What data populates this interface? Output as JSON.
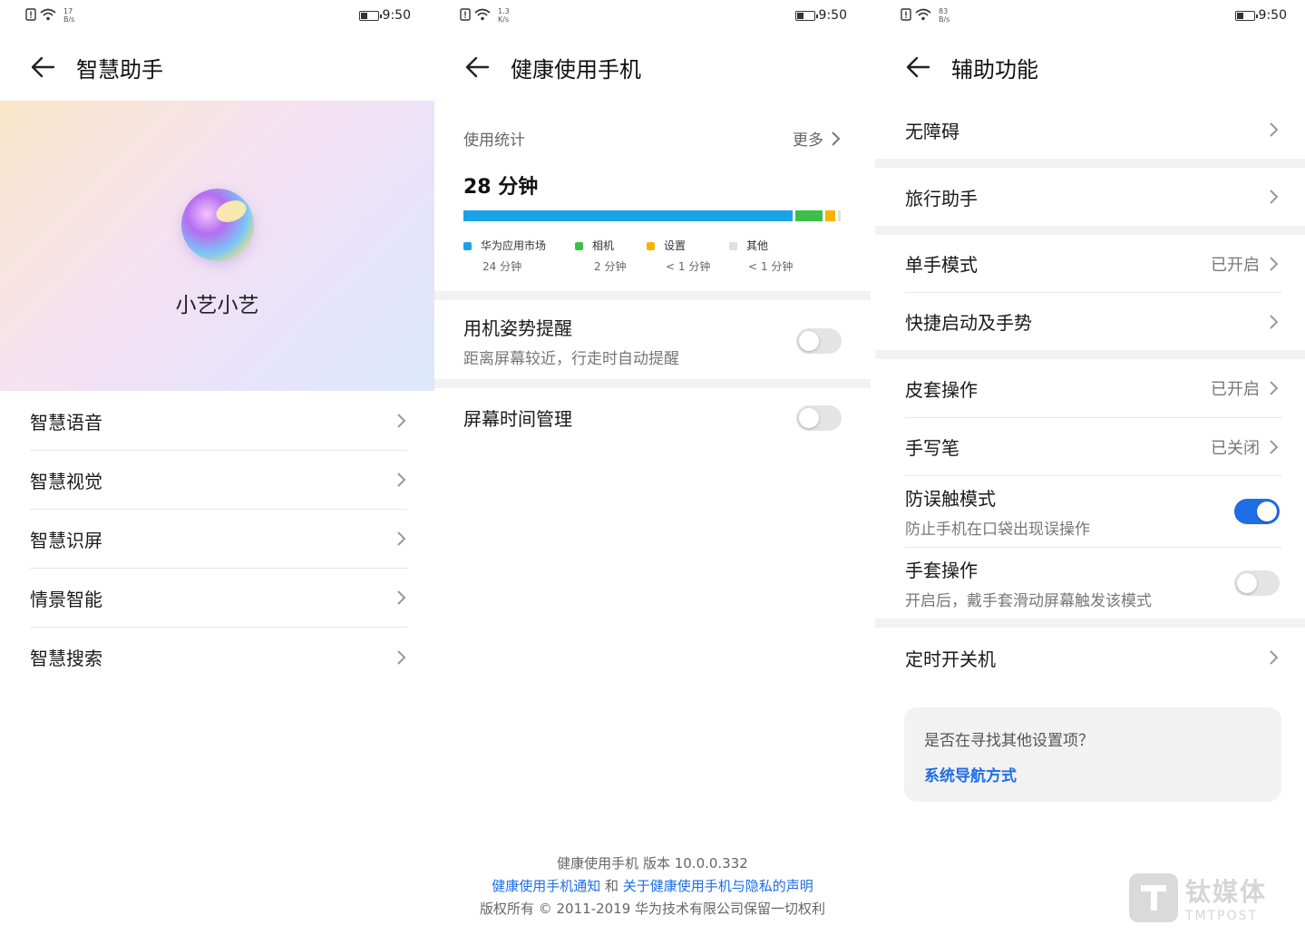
{
  "status_bars": [
    {
      "speed_top": "17",
      "speed_bottom": "B/s",
      "time": "9:50"
    },
    {
      "speed_top": "1.3",
      "speed_bottom": "K/s",
      "time": "9:50"
    },
    {
      "speed_top": "83",
      "speed_bottom": "B/s",
      "time": "9:50"
    }
  ],
  "smart_assistant": {
    "title": "智慧助手",
    "hero_name": "小艺小艺",
    "items": [
      {
        "label": "智慧语音"
      },
      {
        "label": "智慧视觉"
      },
      {
        "label": "智慧识屏"
      },
      {
        "label": "情景智能"
      },
      {
        "label": "智慧搜索"
      }
    ]
  },
  "digital_balance": {
    "title": "健康使用手机",
    "stats_title": "使用统计",
    "more_label": "更多",
    "total": "28 分钟",
    "usage": [
      {
        "name": "华为应用市场",
        "time": "24 分钟",
        "minutes": 24,
        "color": "#1aa3e8"
      },
      {
        "name": "相机",
        "time": "2 分钟",
        "minutes": 2,
        "color": "#3cc04a"
      },
      {
        "name": "设置",
        "time": "< 1 分钟",
        "minutes": 0.7,
        "color": "#f7b500"
      },
      {
        "name": "其他",
        "time": "< 1 分钟",
        "minutes": 0.2,
        "color": "#e0e0e0"
      }
    ],
    "posture": {
      "label": "用机姿势提醒",
      "sub": "距离屏幕较近，行走时自动提醒",
      "on": false
    },
    "screen_time": {
      "label": "屏幕时间管理",
      "on": false
    },
    "footer": {
      "version": "健康使用手机 版本 10.0.0.332",
      "link1": "健康使用手机通知",
      "and": "和",
      "link2": "关于健康使用手机与隐私的声明",
      "copyright": "版权所有 © 2011-2019 华为技术有限公司保留一切权利"
    }
  },
  "accessibility": {
    "title": "辅助功能",
    "items": {
      "accessibility": {
        "label": "无障碍"
      },
      "travel": {
        "label": "旅行助手"
      },
      "one_hand": {
        "label": "单手模式",
        "value": "已开启"
      },
      "shortcuts": {
        "label": "快捷启动及手势"
      },
      "cover": {
        "label": "皮套操作",
        "value": "已开启"
      },
      "stylus": {
        "label": "手写笔",
        "value": "已关闭"
      },
      "accidental": {
        "label": "防误触模式",
        "sub": "防止手机在口袋出现误操作",
        "on": true
      },
      "glove": {
        "label": "手套操作",
        "sub": "开启后，戴手套滑动屏幕触发该模式",
        "on": false
      },
      "schedule": {
        "label": "定时开关机"
      }
    },
    "suggest": {
      "question": "是否在寻找其他设置项？",
      "link": "系统导航方式"
    }
  },
  "watermark": {
    "cn": "钛媒体",
    "en": "TMTPOST"
  },
  "colors": {
    "accent": "#1e6ee6",
    "divider": "#f2f2f2"
  }
}
